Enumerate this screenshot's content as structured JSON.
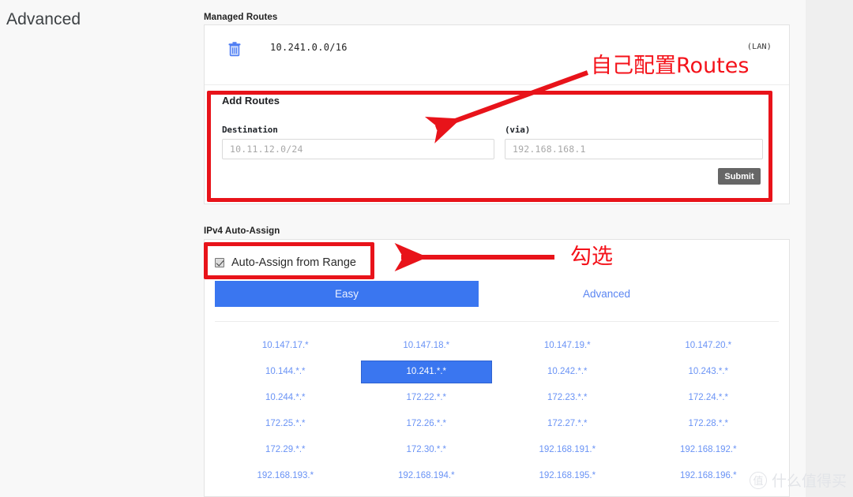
{
  "page": {
    "title": "Advanced"
  },
  "managed_routes": {
    "label": "Managed Routes",
    "rows": [
      {
        "cidr": "10.241.0.0/16",
        "via": "(LAN)",
        "delete_icon": "trash-icon"
      }
    ]
  },
  "add_routes": {
    "title": "Add Routes",
    "destination": {
      "label": "Destination",
      "value": "",
      "placeholder": "10.11.12.0/24"
    },
    "via": {
      "label": "(via)",
      "value": "",
      "placeholder": "192.168.168.1"
    },
    "submit_label": "Submit"
  },
  "ipv4_auto_assign": {
    "label": "IPv4 Auto-Assign",
    "checkbox": {
      "label": "Auto-Assign from Range",
      "checked": true
    },
    "tabs": [
      {
        "label": "Easy",
        "active": true
      },
      {
        "label": "Advanced",
        "active": false
      }
    ],
    "ranges": [
      {
        "label": "10.147.17.*",
        "selected": false
      },
      {
        "label": "10.147.18.*",
        "selected": false
      },
      {
        "label": "10.147.19.*",
        "selected": false
      },
      {
        "label": "10.147.20.*",
        "selected": false
      },
      {
        "label": "10.144.*.*",
        "selected": false
      },
      {
        "label": "10.241.*.*",
        "selected": true
      },
      {
        "label": "10.242.*.*",
        "selected": false
      },
      {
        "label": "10.243.*.*",
        "selected": false
      },
      {
        "label": "10.244.*.*",
        "selected": false
      },
      {
        "label": "172.22.*.*",
        "selected": false
      },
      {
        "label": "172.23.*.*",
        "selected": false
      },
      {
        "label": "172.24.*.*",
        "selected": false
      },
      {
        "label": "172.25.*.*",
        "selected": false
      },
      {
        "label": "172.26.*.*",
        "selected": false
      },
      {
        "label": "172.27.*.*",
        "selected": false
      },
      {
        "label": "172.28.*.*",
        "selected": false
      },
      {
        "label": "172.29.*.*",
        "selected": false
      },
      {
        "label": "172.30.*.*",
        "selected": false
      },
      {
        "label": "192.168.191.*",
        "selected": false
      },
      {
        "label": "192.168.192.*",
        "selected": false
      },
      {
        "label": "192.168.193.*",
        "selected": false
      },
      {
        "label": "192.168.194.*",
        "selected": false
      },
      {
        "label": "192.168.195.*",
        "selected": false
      },
      {
        "label": "192.168.196.*",
        "selected": false
      }
    ]
  },
  "annotations": {
    "routes_note": "自己配置Routes",
    "checkbox_note": "勾选",
    "color": "#f4121a"
  },
  "watermark": {
    "mark": "值",
    "text": "什么值得买"
  },
  "colors": {
    "accent_blue": "#3a76f0",
    "link_blue": "#6a93f5",
    "annotation_red": "#e8131a",
    "submit_gray": "#666666"
  }
}
